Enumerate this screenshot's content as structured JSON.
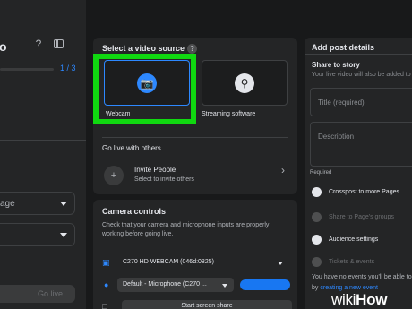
{
  "left": {
    "title": "o",
    "help_icon": "question-icon",
    "sidebar_toggle_icon": "sidebar-toggle-icon",
    "step": "1 / 3",
    "dropdown1": "age",
    "dropdown2": "",
    "go_live": "Go live"
  },
  "source": {
    "header": "Select a video source",
    "help_icon": "question-icon",
    "webcam_label": "Webcam",
    "webcam_icon": "camera-icon",
    "streaming_label": "Streaming software",
    "streaming_icon": "key-icon"
  },
  "others": {
    "header": "Go live with others",
    "invite_title": "Invite People",
    "invite_sub": "Select to invite others",
    "invite_icon": "add-person-icon",
    "chevron_icon": "chevron-right-icon"
  },
  "camera": {
    "header": "Camera controls",
    "desc": "Check that your camera and microphone inputs are properly working before going live.",
    "camera_value": "C270 HD WEBCAM (046d:0825)",
    "mic_value": "Default - Microphone (C270 ...",
    "screen_btn": "Start screen share"
  },
  "post": {
    "header": "Add post details",
    "share_title": "Share to story",
    "share_sub": "Your live video will also be added to",
    "title_placeholder": "Title (required)",
    "desc_placeholder": "Description",
    "required": "Required",
    "crosspost": "Crosspost to more Pages",
    "share_groups": "Share to Page's groups",
    "audience": "Audience settings",
    "tickets": "Tickets & events",
    "events_line1": "You have no events you'll be able to",
    "events_line2_pre": "by",
    "events_link": "creating a new event"
  },
  "watermark": {
    "wiki": "wiki",
    "how": "How"
  },
  "colors": {
    "accent": "#2d88ff",
    "highlight": "#10d810",
    "background": "#18191a",
    "panel": "#242526"
  }
}
